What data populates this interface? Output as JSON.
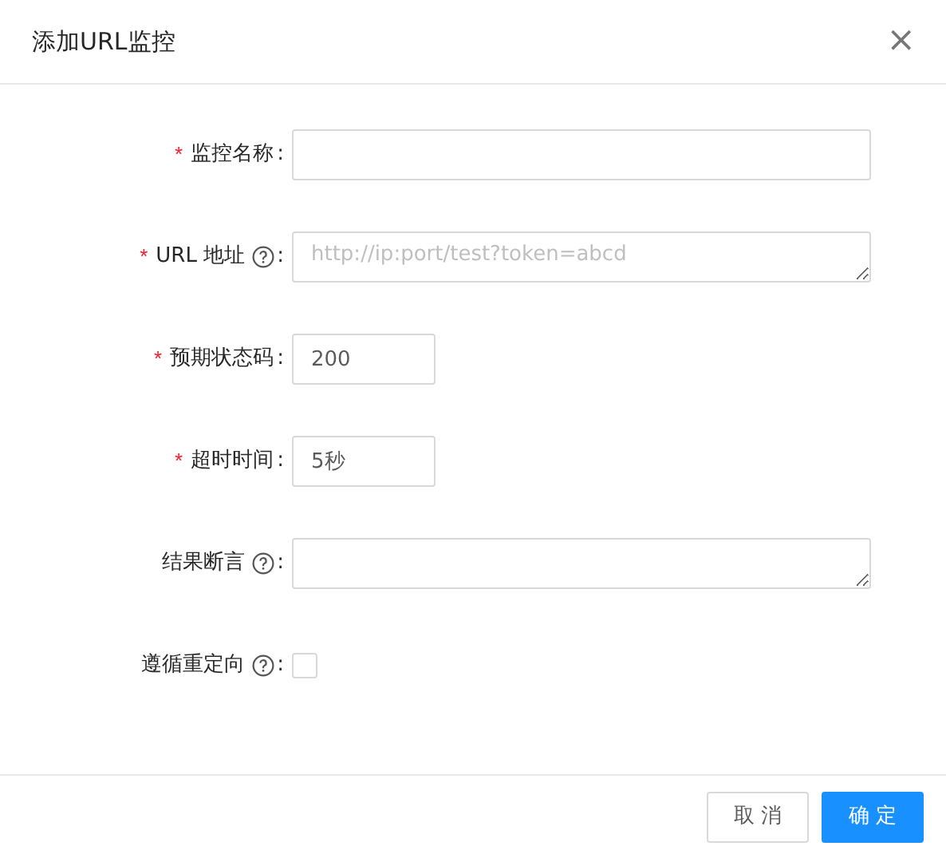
{
  "dialog": {
    "title": "添加URL监控",
    "close": "×"
  },
  "fields": [
    {
      "kind": "input",
      "required_mark": "*",
      "label": "监控名称",
      "help": false,
      "colon": ":"
    },
    {
      "kind": "textarea",
      "required_mark": "*",
      "label": "URL 地址",
      "help": true,
      "colon": ":",
      "placeholder": "http://ip:port/test?token=abcd"
    },
    {
      "kind": "short",
      "required_mark": "*",
      "label": "预期状态码",
      "help": false,
      "colon": ":",
      "value": "200"
    },
    {
      "kind": "short",
      "required_mark": "*",
      "label": "超时时间",
      "help": false,
      "colon": ":",
      "value": "5秒"
    },
    {
      "kind": "textarea",
      "label": "结果断言",
      "help": true,
      "colon": ":"
    },
    {
      "kind": "checkbox",
      "label": "遵循重定向",
      "help": true,
      "colon": ":",
      "checked": false
    }
  ],
  "buttons": [
    {
      "label": "取 消",
      "kind": "default"
    },
    {
      "label": "确 定",
      "kind": "primary"
    }
  ]
}
